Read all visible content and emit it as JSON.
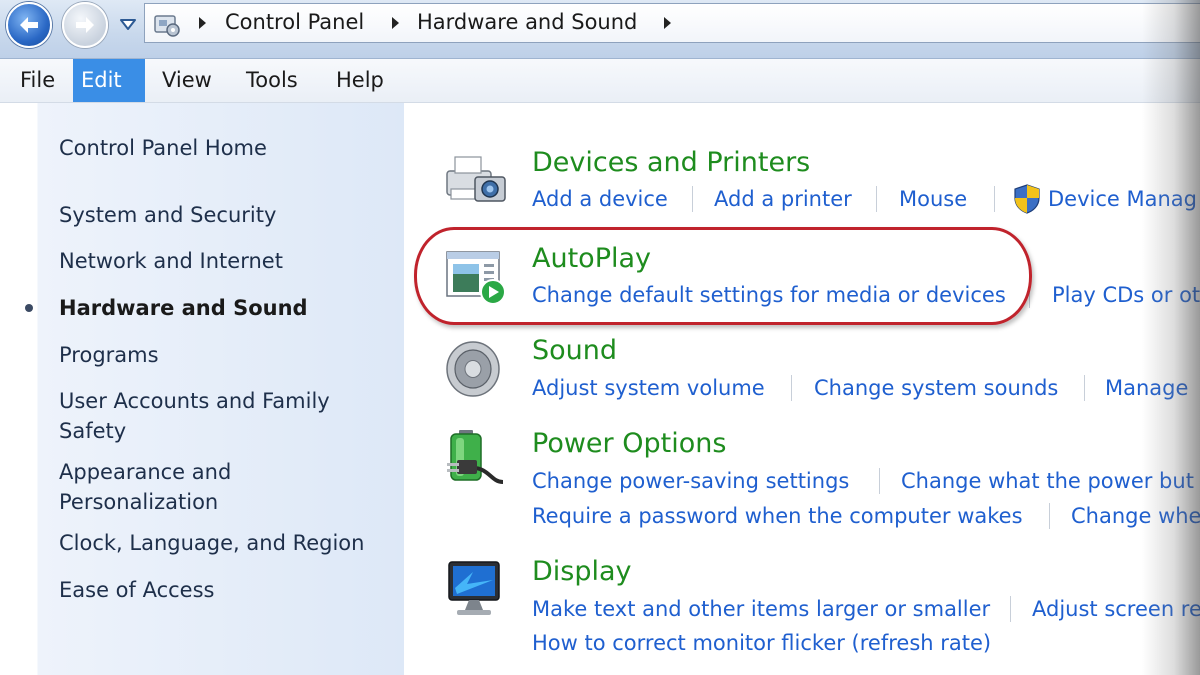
{
  "address_bar": {
    "breadcrumbs": [
      "Control Panel",
      "Hardware and Sound"
    ]
  },
  "menu": {
    "items": [
      "File",
      "Edit",
      "View",
      "Tools",
      "Help"
    ],
    "active": "Edit"
  },
  "sidebar": {
    "items": [
      "Control Panel Home",
      "System and Security",
      "Network and Internet",
      "Hardware and Sound",
      "Programs",
      "User Accounts and Family Safety",
      "Appearance and Personalization",
      "Clock, Language, and Region",
      "Ease of Access"
    ],
    "current": "Hardware and Sound"
  },
  "categories": [
    {
      "title": "Devices and Printers",
      "icon": "printer-camera-icon",
      "links": [
        "Add a device",
        "Add a printer",
        "Mouse",
        "Device Manag"
      ]
    },
    {
      "title": "AutoPlay",
      "icon": "autoplay-icon",
      "links": [
        "Change default settings for media or devices",
        "Play CDs or ot"
      ]
    },
    {
      "title": "Sound",
      "icon": "speaker-icon",
      "links": [
        "Adjust system volume",
        "Change system sounds",
        "Manage"
      ]
    },
    {
      "title": "Power Options",
      "icon": "battery-plug-icon",
      "links": [
        "Change power-saving settings",
        "Change what the power but",
        "Require a password when the computer wakes",
        "Change whe"
      ]
    },
    {
      "title": "Display",
      "icon": "monitor-icon",
      "links": [
        "Make text and other items larger or smaller",
        "Adjust screen re",
        "How to correct monitor flicker (refresh rate)"
      ]
    }
  ],
  "colors": {
    "category_title": "#1e8c1e",
    "link": "#1f5fcf",
    "highlight": "#c0232c",
    "menu_active": "#3a8ee6"
  }
}
